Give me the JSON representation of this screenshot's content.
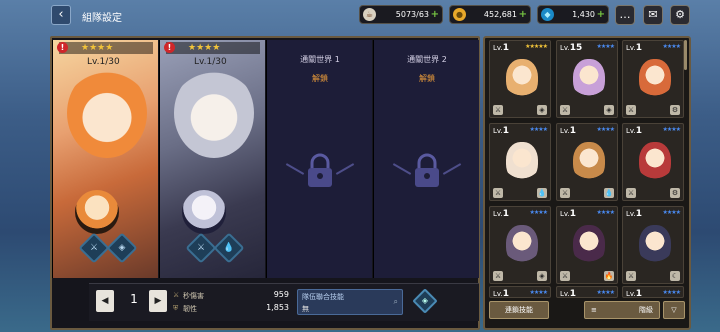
{
  "header": {
    "title": "組隊設定",
    "back_icon": "back-arrow-icon"
  },
  "resources": [
    {
      "name": "stamina",
      "value": "5073/63",
      "icon": "coffee-icon"
    },
    {
      "name": "gold",
      "value": "452,681",
      "icon": "coin-icon"
    },
    {
      "name": "gems",
      "value": "1,430",
      "icon": "diamond-icon"
    }
  ],
  "header_buttons": [
    "chat-icon",
    "mail-icon",
    "gear-icon"
  ],
  "team": {
    "slots": [
      {
        "type": "hero",
        "level": "1/30",
        "alert": "!",
        "stars": "★★★★"
      },
      {
        "type": "hero",
        "level": "1/30",
        "alert": "!",
        "stars": "★★★★"
      },
      {
        "type": "locked",
        "title": "通關世界 1",
        "unlock": "解鎖"
      },
      {
        "type": "locked",
        "title": "通關世界 2",
        "unlock": "解鎖"
      }
    ]
  },
  "bottom": {
    "prev_label": "◀",
    "next_label": "▶",
    "team_number": "1",
    "stats": [
      {
        "label": "秒傷害",
        "value": "959"
      },
      {
        "label": "韌性",
        "value": "1,853"
      }
    ],
    "skill_title": "隊伍聯合技能",
    "skill_value": "無"
  },
  "roster": {
    "tiles": [
      {
        "lv": "1",
        "stars": "★★★★★",
        "star_color": "gold",
        "portrait": "#e8b070"
      },
      {
        "lv": "15",
        "stars": "★★★★",
        "star_color": "blue",
        "portrait": "#c8a0d8"
      },
      {
        "lv": "1",
        "stars": "★★★★",
        "star_color": "blue",
        "portrait": "#d86a3a"
      },
      {
        "lv": "1",
        "stars": "★★★★",
        "star_color": "blue",
        "portrait": "#f0e0d0"
      },
      {
        "lv": "1",
        "stars": "★★★★",
        "star_color": "blue",
        "portrait": "#c88a4a"
      },
      {
        "lv": "1",
        "stars": "★★★★",
        "star_color": "blue",
        "portrait": "#b83a3a"
      },
      {
        "lv": "1",
        "stars": "★★★★",
        "star_color": "blue",
        "portrait": "#6a5a7a"
      },
      {
        "lv": "1",
        "stars": "★★★★",
        "star_color": "blue",
        "portrait": "#4a2a4a"
      },
      {
        "lv": "1",
        "stars": "★★★★",
        "star_color": "blue",
        "portrait": "#3a3a5a"
      },
      {
        "lv": "1",
        "stars": "★★★★",
        "star_color": "blue",
        "portrait": "#6a5a40"
      },
      {
        "lv": "1",
        "stars": "★★★★",
        "star_color": "blue",
        "portrait": "#6a5a40"
      },
      {
        "lv": "1",
        "stars": "★★★★",
        "star_color": "blue",
        "portrait": "#6a5a40"
      }
    ],
    "link_skill_label": "連鎖技能",
    "sort_label": "階級"
  }
}
